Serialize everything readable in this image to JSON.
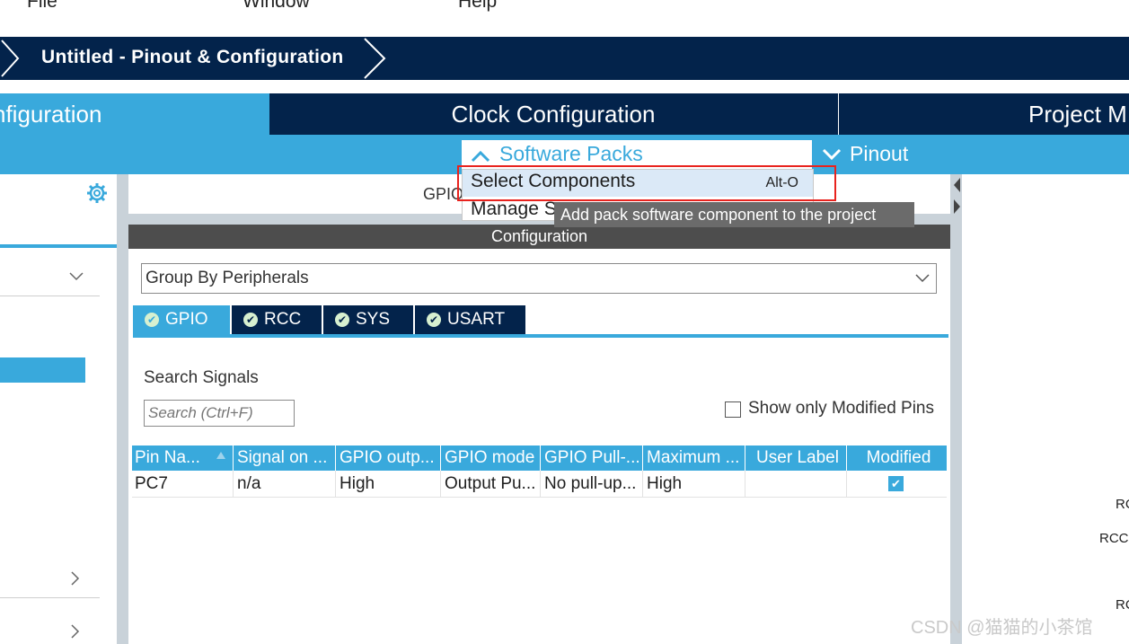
{
  "menu": {
    "items": [
      "File",
      "Window",
      "Help"
    ]
  },
  "breadcrumb": {
    "title": "Untitled - Pinout & Configuration"
  },
  "main_tabs": {
    "pinout": "nfiguration",
    "clock": "Clock Configuration",
    "project": "Project M"
  },
  "subbar": {
    "software_packs": "Software Packs",
    "pinout": "Pinout"
  },
  "dropdown": {
    "select_components": "Select Components",
    "select_shortcut": "Alt-O",
    "manage": "Manage S"
  },
  "tooltip": {
    "text": "Add pack software component to the project"
  },
  "mode_panel": {
    "label": "GPIO"
  },
  "config": {
    "header": "Configuration",
    "group_by": "Group By Peripherals",
    "tabs": [
      "GPIO",
      "RCC",
      "SYS",
      "USART"
    ],
    "search_label": "Search Signals",
    "search_placeholder": "Search (Ctrl+F)",
    "show_modified": "Show only Modified Pins",
    "table": {
      "headers": [
        "Pin Na...",
        "Signal on ...",
        "GPIO outp...",
        "GPIO mode",
        "GPIO Pull-...",
        "Maximum ...",
        "User Label",
        "Modified"
      ],
      "rows": [
        [
          "PC7",
          "n/a",
          "High",
          "Output Pu...",
          "No pull-up...",
          "High",
          ""
        ]
      ]
    }
  },
  "right_panel": {
    "labels": [
      "RC",
      "RCC",
      "RC"
    ]
  },
  "watermark": "CSDN @猫猫的小茶馆",
  "colors": {
    "navy": "#03234b",
    "accent": "#39a9dc",
    "highlight": "#e8231e",
    "tooltip": "#6b6b6b"
  }
}
